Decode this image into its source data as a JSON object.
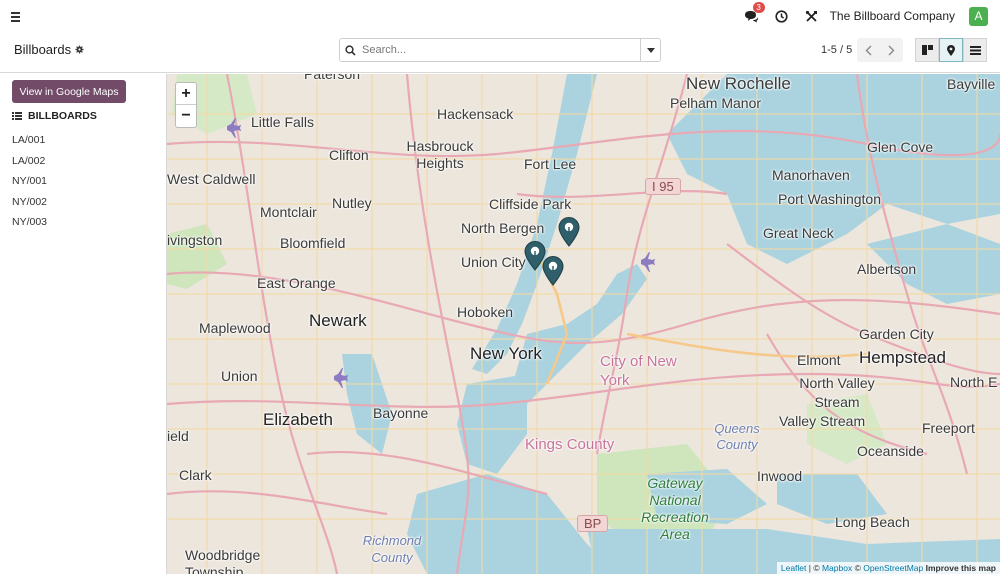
{
  "topbar": {
    "company": "The Billboard Company",
    "avatar_letter": "A",
    "messages_count": "3"
  },
  "control": {
    "title": "Billboards",
    "search_placeholder": "Search...",
    "pager": "1-5 / 5"
  },
  "sidebar": {
    "google_maps_button": "View in Google Maps",
    "section_title": "BILLBOARDS",
    "items": [
      "LA/001",
      "LA/002",
      "NY/001",
      "NY/002",
      "NY/003"
    ]
  },
  "map": {
    "labels": {
      "paterson": "Paterson",
      "new_rochelle": "New Rochelle",
      "bayville": "Bayville",
      "pelham_manor": "Pelham Manor",
      "little_falls": "Little Falls",
      "hackensack": "Hackensack",
      "clifton": "Clifton",
      "hasbrouck_heights": "Hasbrouck Heights",
      "fort_lee": "Fort Lee",
      "glen_cove": "Glen Cove",
      "west_caldwell": "West Caldwell",
      "cliffside_park": "Cliffside Park",
      "manorhaven": "Manorhaven",
      "nutley": "Nutley",
      "port_washington": "Port Washington",
      "montclair": "Montclair",
      "north_bergen": "North Bergen",
      "great_neck": "Great Neck",
      "livingston": "ivingston",
      "bloomfield": "Bloomfield",
      "union_city": "Union City",
      "albertson": "Albertson",
      "east_orange": "East Orange",
      "hoboken": "Hoboken",
      "maplewood": "Maplewood",
      "newark": "Newark",
      "garden_city": "Garden City",
      "new_york": "New York",
      "city_of_new_york": "City of New York",
      "elmont": "Elmont",
      "hempstead": "Hempstead",
      "union": "Union",
      "north_valley_stream": "North Valley Stream",
      "north_e": "North E",
      "bayonne": "Bayonne",
      "elizabeth": "Elizabeth",
      "valley_stream": "Valley Stream",
      "freeport": "Freeport",
      "kings_county": "Kings County",
      "queens_county": "Queens County",
      "field": "ield",
      "clark": "Clark",
      "oceanside": "Oceanside",
      "inwood": "Inwood",
      "gateway": "Gateway National Recreation Area",
      "long_beach": "Long Beach",
      "richmond_county": "Richmond County",
      "woodbridge": "Woodbridge Township"
    },
    "shields": {
      "i95": "I 95",
      "bp": "BP"
    },
    "zoom_in": "+",
    "zoom_out": "−",
    "attribution": {
      "leaflet": "Leaflet",
      "sep1": " | © ",
      "mapbox": "Mapbox",
      "sep2": " © ",
      "osm": "OpenStreetMap",
      "improve": "Improve this map"
    },
    "marker_color": "#2f5f6a"
  },
  "colors": {
    "brand": "#714b67",
    "accent": "#7fb6bf",
    "badge": "#e04b4b",
    "avatar_bg": "#4caf50",
    "water": "#aad3df",
    "park": "#c8e6b4"
  }
}
